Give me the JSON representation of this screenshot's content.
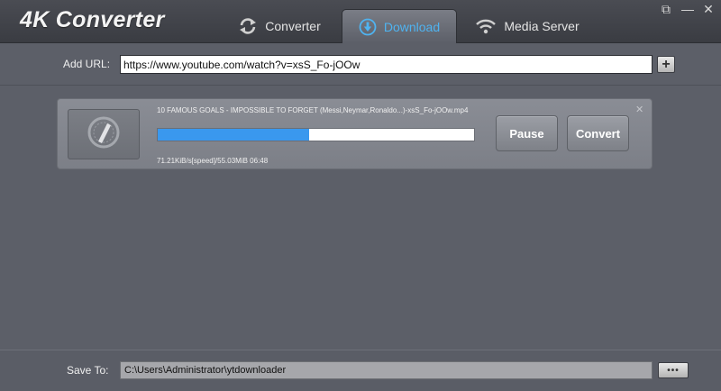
{
  "app": {
    "title": "4K Converter"
  },
  "tabs": [
    {
      "label": "Converter",
      "icon": "refresh-icon",
      "active": false
    },
    {
      "label": "Download",
      "icon": "download-icon",
      "active": true
    },
    {
      "label": "Media Server",
      "icon": "wifi-icon",
      "active": false
    }
  ],
  "window_controls": {
    "popout": "⧉",
    "minimize": "—",
    "close": "✕"
  },
  "url_bar": {
    "label": "Add URL:",
    "value": "https://www.youtube.com/watch?v=xsS_Fo-jOOw",
    "add_button": "+"
  },
  "download": {
    "file_name": "10 FAMOUS GOALS - IMPOSSIBLE TO FORGET (Messi,Neymar,Ronaldo...)-xsS_Fo-jOOw.mp4",
    "progress": 0.48,
    "status": "71.21KiB/s[speed]/55.03MiB 06:48",
    "pause_label": "Pause",
    "convert_label": "Convert",
    "close": "✕"
  },
  "save": {
    "label": "Save To:",
    "path": "C:\\Users\\Administrator\\ytdownloader",
    "browse": "•••"
  },
  "colors": {
    "accent": "#3a98ee",
    "active_tab_text": "#4fb3f0",
    "background": "#5c5f68"
  }
}
